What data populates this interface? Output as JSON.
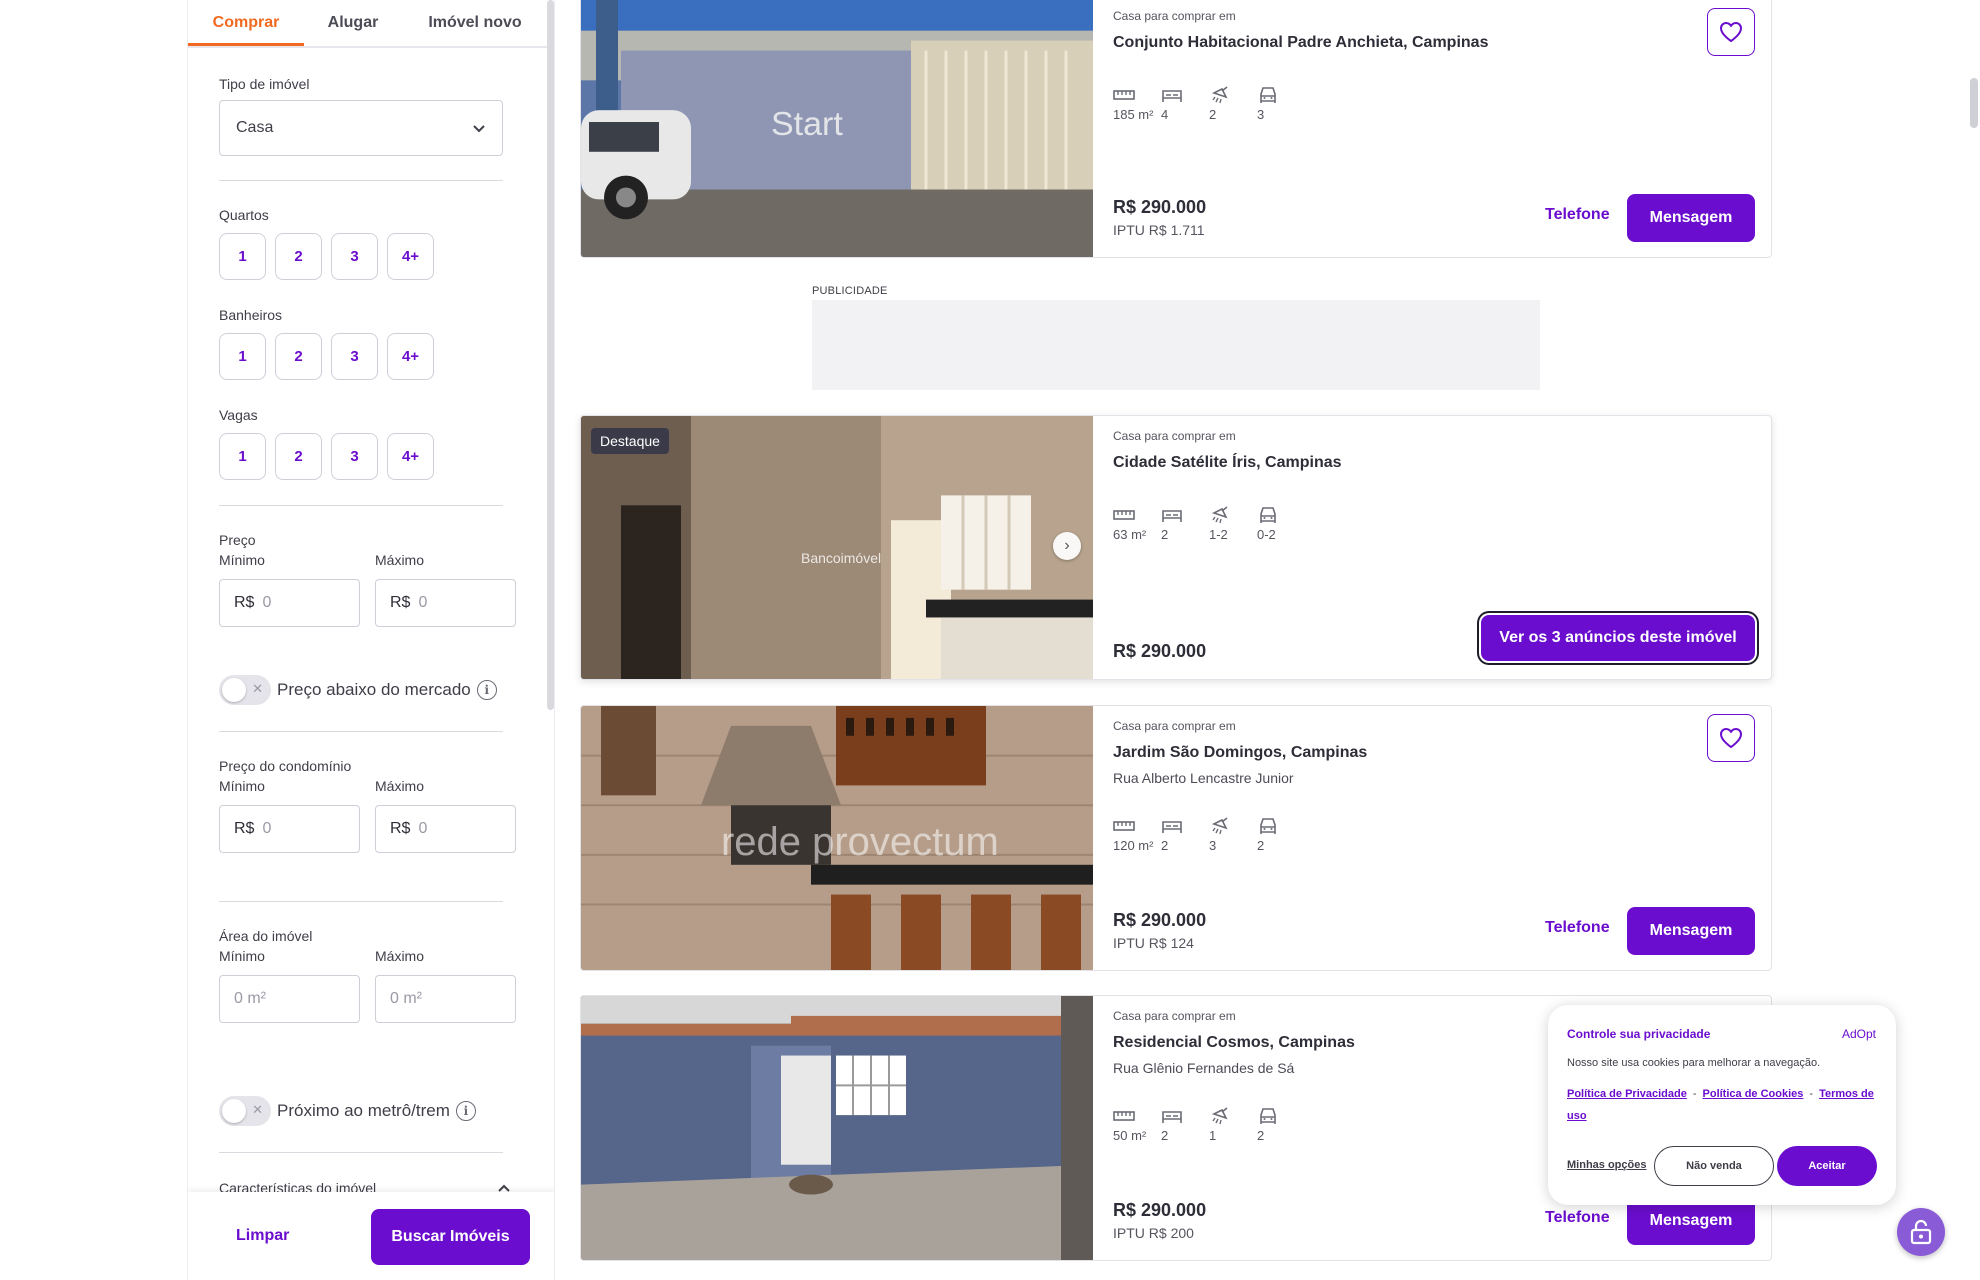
{
  "sidebar": {
    "tabs": [
      "Comprar",
      "Alugar",
      "Imóvel novo"
    ],
    "tipo_label": "Tipo de imóvel",
    "tipo_value": "Casa",
    "quartos_label": "Quartos",
    "banheiros_label": "Banheiros",
    "vagas_label": "Vagas",
    "chip_options": [
      "1",
      "2",
      "3",
      "4+"
    ],
    "preco_label": "Preço",
    "min_label": "Mínimo",
    "max_label": "Máximo",
    "currency": "R$",
    "money_placeholder": "0",
    "area_placeholder": "0 m²",
    "preco_abaixo_label": "Preço abaixo do mercado",
    "condominio_label": "Preço do condomínio",
    "area_label": "Área do imóvel",
    "metro_label": "Próximo ao metrô/trem",
    "caracteristicas_label": "Características do imóvel",
    "limpar": "Limpar",
    "buscar": "Buscar Imóveis"
  },
  "ad": {
    "label": "PUBLICIDADE"
  },
  "listings": [
    {
      "kicker": "Casa para comprar em",
      "location": "Conjunto Habitacional Padre Anchieta, Campinas",
      "street": "",
      "area": "185 m²",
      "bedrooms": "4",
      "bathrooms": "2",
      "parking": "3",
      "price": "R$ 290.000",
      "iptu": "IPTU R$ 1.711",
      "phone": "Telefone",
      "message": "Mensagem",
      "watermark": "Start"
    },
    {
      "badge": "Destaque",
      "kicker": "Casa para comprar em",
      "location": "Cidade Satélite Íris, Campinas",
      "area": "63 m²",
      "bedrooms": "2",
      "bathrooms": "1-2",
      "parking": "0-2",
      "price": "R$ 290.000",
      "cta": "Ver os 3 anúncios deste imóvel",
      "watermark": "Bancoimóvel"
    },
    {
      "kicker": "Casa para comprar em",
      "location": "Jardim São Domingos, Campinas",
      "street": "Rua Alberto Lencastre Junior",
      "area": "120 m²",
      "bedrooms": "2",
      "bathrooms": "3",
      "parking": "2",
      "price": "R$ 290.000",
      "iptu": "IPTU R$ 124",
      "phone": "Telefone",
      "message": "Mensagem",
      "watermark": "rede provectum"
    },
    {
      "kicker": "Casa para comprar em",
      "location": "Residencial Cosmos, Campinas",
      "street": "Rua Glênio Fernandes de Sá",
      "area": "50 m²",
      "bedrooms": "2",
      "bathrooms": "1",
      "parking": "2",
      "price": "R$ 290.000",
      "iptu": "IPTU R$ 200",
      "phone": "Telefone",
      "message": "Mensagem"
    }
  ],
  "privacy": {
    "title": "Controle sua privacidade",
    "brand": "AdOpt",
    "text": "Nosso site usa cookies para melhorar a navegação.",
    "link_privacidade": "Política de Privacidade",
    "link_cookies": "Política de Cookies",
    "link_termos": "Termos de uso",
    "opcoes": "Minhas opções",
    "nao_venda": "Não venda",
    "aceitar": "Aceitar"
  },
  "colors": {
    "brand": "#6a0dce",
    "active_tab": "#f26a21"
  }
}
